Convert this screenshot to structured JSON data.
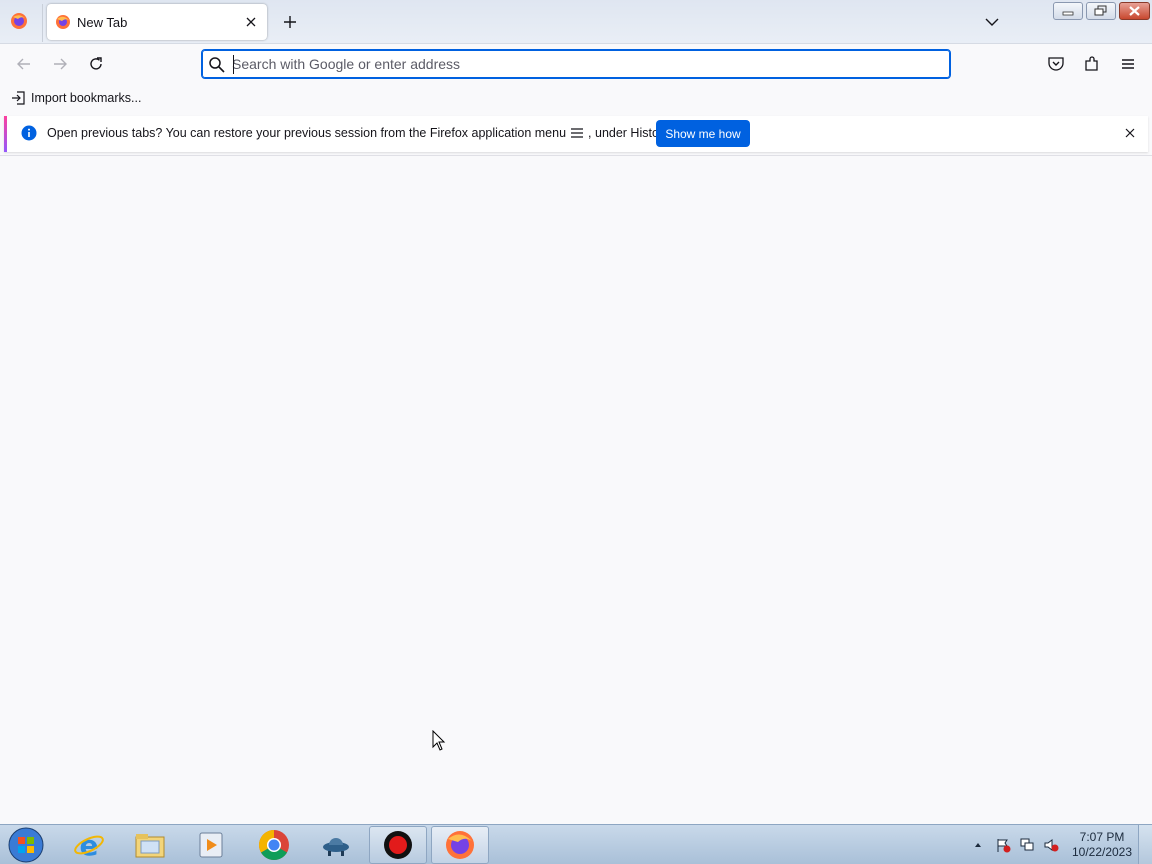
{
  "window": {
    "tab": {
      "title": "New Tab"
    },
    "controls": {
      "minimize": "minimize",
      "maximize": "restore",
      "close": "close"
    }
  },
  "navbar": {
    "urlbar": {
      "placeholder": "Search with Google or enter address",
      "value": ""
    }
  },
  "bookmarks": {
    "import_label": "Import bookmarks..."
  },
  "notification": {
    "message_before": "Open previous tabs? You can restore your previous session from the Firefox application menu",
    "message_after": ", under History.",
    "action_label": "Show me how"
  },
  "taskbar": {
    "apps": [
      "start",
      "internet-explorer",
      "file-explorer",
      "media-player",
      "chrome",
      "app-ufo",
      "recorder",
      "firefox"
    ],
    "clock": {
      "time": "7:07 PM",
      "date": "10/22/2023"
    }
  },
  "colors": {
    "accent": "#0061e0",
    "background": "#f9f9fb"
  }
}
